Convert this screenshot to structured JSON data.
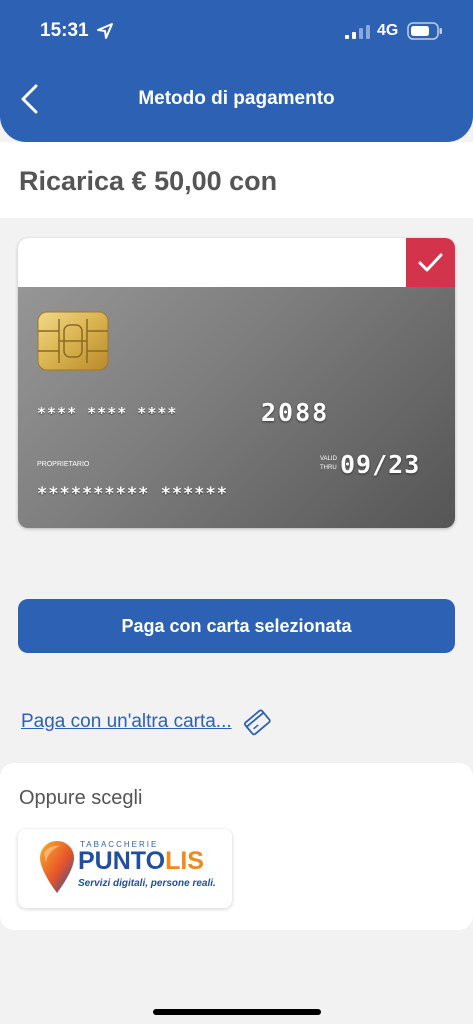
{
  "status_bar": {
    "time": "15:31",
    "network": "4G"
  },
  "header": {
    "title": "Metodo di pagamento"
  },
  "amount": {
    "text": "Ricarica € 50,00 con"
  },
  "card": {
    "number_masked": "**** **** ****",
    "number_last": "2088",
    "owner_label": "PROPRIETARIO",
    "valid_label_1": "VALID",
    "valid_label_2": "THRU",
    "expiry": "09/23",
    "owner_masked": "********** ******",
    "selected": true
  },
  "actions": {
    "pay_button": "Paga con carta selezionata",
    "other_card_link": "Paga con un'altra carta..."
  },
  "alternatives": {
    "label": "Oppure scegli",
    "provider_top": "TABACCHERIE",
    "provider_name_a": "PUNTO",
    "provider_name_b": "LIS",
    "provider_tagline": "Servizi digitali, persone reali."
  },
  "colors": {
    "primary": "#2d61b4",
    "accent_red": "#d4344b",
    "brand_orange": "#f08a1c"
  }
}
